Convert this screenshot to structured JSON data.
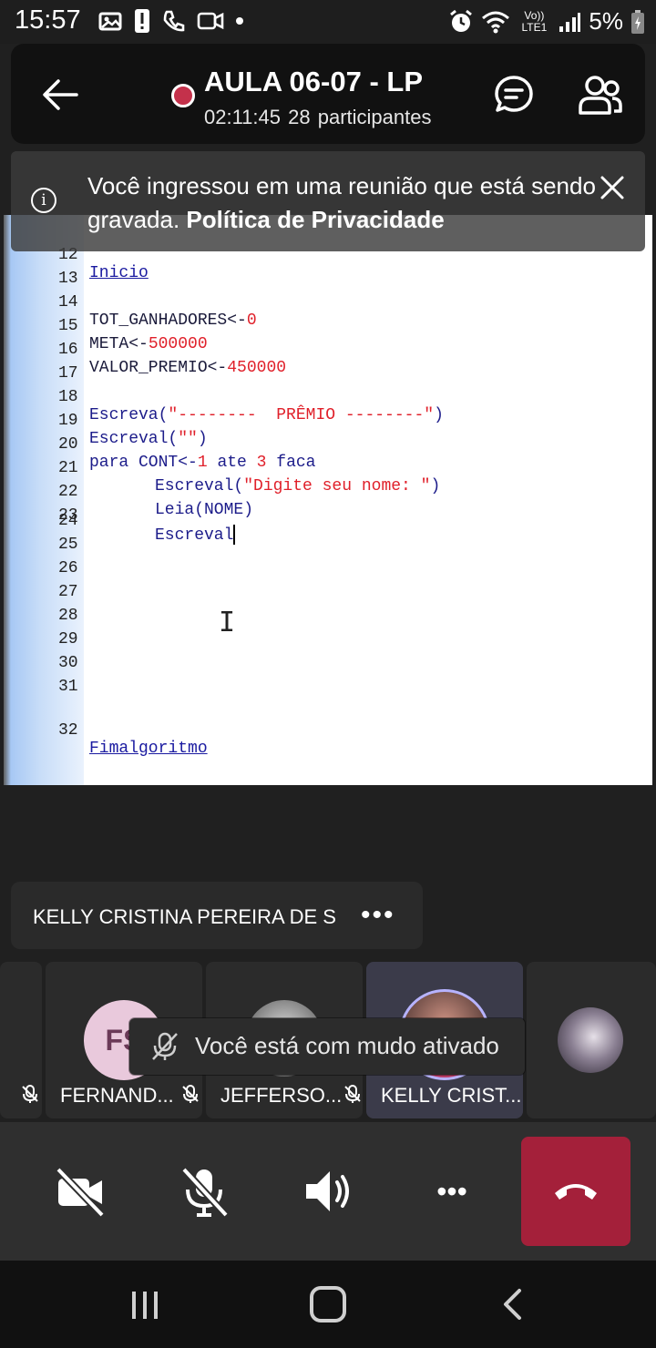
{
  "status_bar": {
    "time": "15:57",
    "network": "Vo)) LTE1",
    "battery": "5%"
  },
  "header": {
    "title": "AULA 06-07 - LP",
    "duration": "02:11:45",
    "participants": "28 participantes"
  },
  "banner": {
    "text": "Você ingressou em uma reunião que está sendo gravada.",
    "link": "Política de Privacidade"
  },
  "code": {
    "lines": [
      {
        "n": "12",
        "text": "Inicio"
      },
      {
        "n": "13",
        "text": ""
      },
      {
        "n": "14",
        "text": "TOT_GANHADORES<-0"
      },
      {
        "n": "15",
        "text": "META<-500000"
      },
      {
        "n": "16",
        "text": "VALOR_PREMIO<-450000"
      },
      {
        "n": "17",
        "text": ""
      },
      {
        "n": "18",
        "text": "Escreva(\"--------  PRÊMIO --------\")"
      },
      {
        "n": "19",
        "text": "Escreval(\"\")"
      },
      {
        "n": "20",
        "text": "para CONT<-1 ate 3 faca"
      },
      {
        "n": "21",
        "text": "Escreval(\"Digite seu nome: \")"
      },
      {
        "n": "22",
        "text": "Leia(NOME)"
      },
      {
        "n": "23",
        "text": "Escreval"
      },
      {
        "n": "24",
        "text": ""
      },
      {
        "n": "25",
        "text": ""
      },
      {
        "n": "26",
        "text": ""
      },
      {
        "n": "27",
        "text": ""
      },
      {
        "n": "28",
        "text": ""
      },
      {
        "n": "29",
        "text": ""
      },
      {
        "n": "30",
        "text": ""
      },
      {
        "n": "31",
        "text": ""
      },
      {
        "n": "32",
        "text": "Fimalgoritmo"
      }
    ],
    "parts": {
      "l14_a": "TOT_GANHADORES<-",
      "l14_b": "0",
      "l15_a": "META<-",
      "l15_b": "500000",
      "l16_a": "VALOR_PREMIO<-",
      "l16_b": "450000",
      "l18_a": "Escreva(",
      "l18_b": "\"--------  PRÊMIO --------\"",
      "l18_c": ")",
      "l19_a": "Escreval(",
      "l19_b": "\"\"",
      "l19_c": ")",
      "l20_a": "para CONT<-",
      "l20_b": "1",
      "l20_c": " ate ",
      "l20_d": "3",
      "l20_e": " faca",
      "l21_a": "Escreval(",
      "l21_b": "\"Digite seu nome: \"",
      "l21_c": ")",
      "l22": "Leia(NOME)",
      "l23": "Escreval"
    }
  },
  "speaker": {
    "name": "KELLY CRISTINA PEREIRA DE S",
    "more": "•••"
  },
  "participants": [
    {
      "name": "FERNAND...",
      "initials": "FS"
    },
    {
      "name": "JEFFERSO..."
    },
    {
      "name": "KELLY CRIST..."
    }
  ],
  "toast": {
    "text": "Você está com mudo ativado"
  },
  "controls": {
    "more": "•••"
  },
  "colors": {
    "end_call": "#a4203a",
    "record": "#c4314b",
    "code_string": "#e0202a",
    "code_keyword": "#1c1c8a"
  }
}
